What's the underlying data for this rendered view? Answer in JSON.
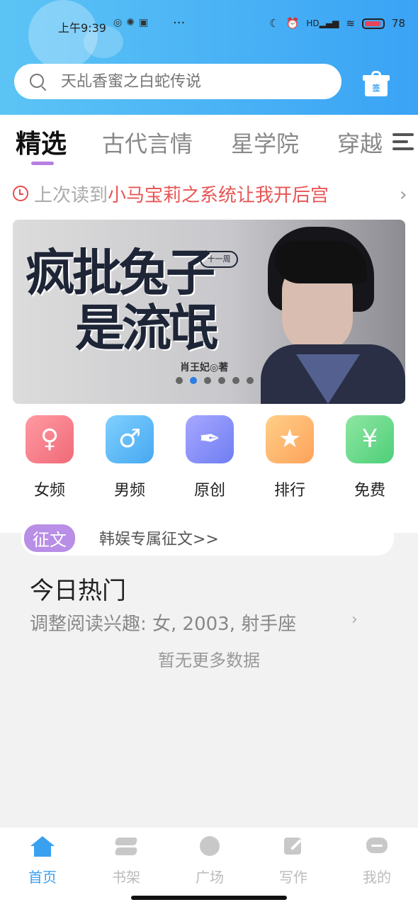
{
  "statusbar": {
    "time": "上午9:39",
    "battery": "78"
  },
  "search": {
    "placeholder": "天乩香蜜之白蛇传说"
  },
  "gift_icon_label": "签",
  "tabs": [
    "精选",
    "古代言情",
    "星学院",
    "穿越"
  ],
  "last_read": {
    "label": "上次读到",
    "title": "小马宝莉之系统让我开后宫"
  },
  "banner": {
    "title_line1": "疯批兔子",
    "title_line2": "是流氓",
    "author": "肖王妃◎著",
    "badge": "十一周",
    "slide_count": 6,
    "active_slide": 2
  },
  "categories": [
    {
      "label": "女频",
      "icon": "female-icon",
      "color": "#f06a78"
    },
    {
      "label": "男频",
      "icon": "male-icon",
      "color": "#47a8f0"
    },
    {
      "label": "原创",
      "icon": "pen-nib-icon",
      "color": "#6f7ef2"
    },
    {
      "label": "排行",
      "icon": "podium-icon",
      "color": "#fda25a"
    },
    {
      "label": "免费",
      "icon": "yen-coin-icon",
      "color": "#4ecf7a"
    }
  ],
  "contest": {
    "tag": "征文",
    "text": "韩娱专属征文>>"
  },
  "hot": {
    "title": "今日热门",
    "subtitle": "调整阅读兴趣: 女, 2003, 射手座",
    "empty": "暂无更多数据"
  },
  "tabbar": [
    {
      "label": "首页",
      "icon": "home-icon",
      "active": true
    },
    {
      "label": "书架",
      "icon": "bookshelf-icon",
      "active": false
    },
    {
      "label": "广场",
      "icon": "planet-icon",
      "active": false
    },
    {
      "label": "写作",
      "icon": "write-icon",
      "active": false
    },
    {
      "label": "我的",
      "icon": "chat-bubble-icon",
      "active": false
    }
  ],
  "colors": {
    "header_start": "#5cc4f5",
    "header_end": "#3aa3f5",
    "accent": "#3aa0f0",
    "tab_underline": "#b77fe0",
    "last_read_title": "#e85555"
  }
}
